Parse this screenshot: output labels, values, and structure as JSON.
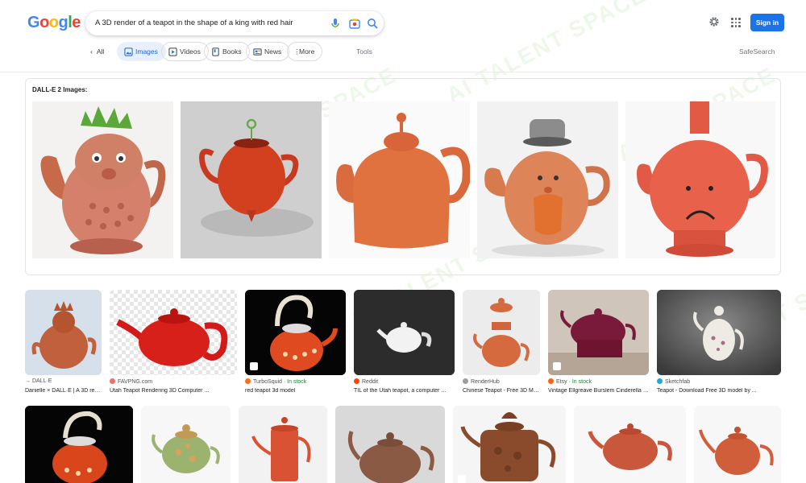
{
  "logo": {
    "letters": [
      "G",
      "o",
      "o",
      "g",
      "l",
      "e"
    ],
    "colors": [
      "#4285f4",
      "#ea4335",
      "#fbbc05",
      "#4285f4",
      "#34a853",
      "#ea4335"
    ]
  },
  "search": {
    "query": "A 3D render of a teapot in the shape of a king with red hair"
  },
  "header": {
    "signin_label": "Sign in"
  },
  "nav": {
    "all_label": "All",
    "tabs": [
      {
        "label": "Images",
        "icon": "image-icon"
      },
      {
        "label": "Videos",
        "icon": "video-icon"
      },
      {
        "label": "Books",
        "icon": "book-icon"
      },
      {
        "label": "News",
        "icon": "news-icon"
      },
      {
        "label": "More",
        "icon": "more-icon"
      }
    ],
    "tools_label": "Tools",
    "safesearch_label": "SafeSearch"
  },
  "dalle": {
    "title": "DALL-E 2 Images:"
  },
  "results_row1": [
    {
      "source": "DALL·E",
      "source_prefix": "→",
      "stock": "",
      "caption": "Danielle × DALL·E | A 3D rend..."
    },
    {
      "source": "FAVPNG.com",
      "source_prefix": "",
      "stock": "",
      "caption": "Utah Teapot Rendering 3D Computer ..."
    },
    {
      "source": "TurboSquid",
      "source_prefix": "",
      "stock": "In stock",
      "caption": "red teapot 3d model"
    },
    {
      "source": "Reddit",
      "source_prefix": "",
      "stock": "",
      "caption": "TIL of the Utah teapot, a computer ..."
    },
    {
      "source": "RenderHub",
      "source_prefix": "",
      "stock": "",
      "caption": "Chinese Teapot - Free 3D Mo..."
    },
    {
      "source": "Etsy",
      "source_prefix": "",
      "stock": "In stock",
      "caption": "Vintage Ellgreave Burslem Cinderella 3..."
    },
    {
      "source": "Sketchfab",
      "source_prefix": "",
      "stock": "",
      "caption": "Teapot - Download Free 3D model by ..."
    }
  ],
  "watermark": "AI TALENT SPACE",
  "colors": {
    "accent": "#1a73e8",
    "active_chip_bg": "#e8f0fe",
    "stock_green": "#188038"
  }
}
